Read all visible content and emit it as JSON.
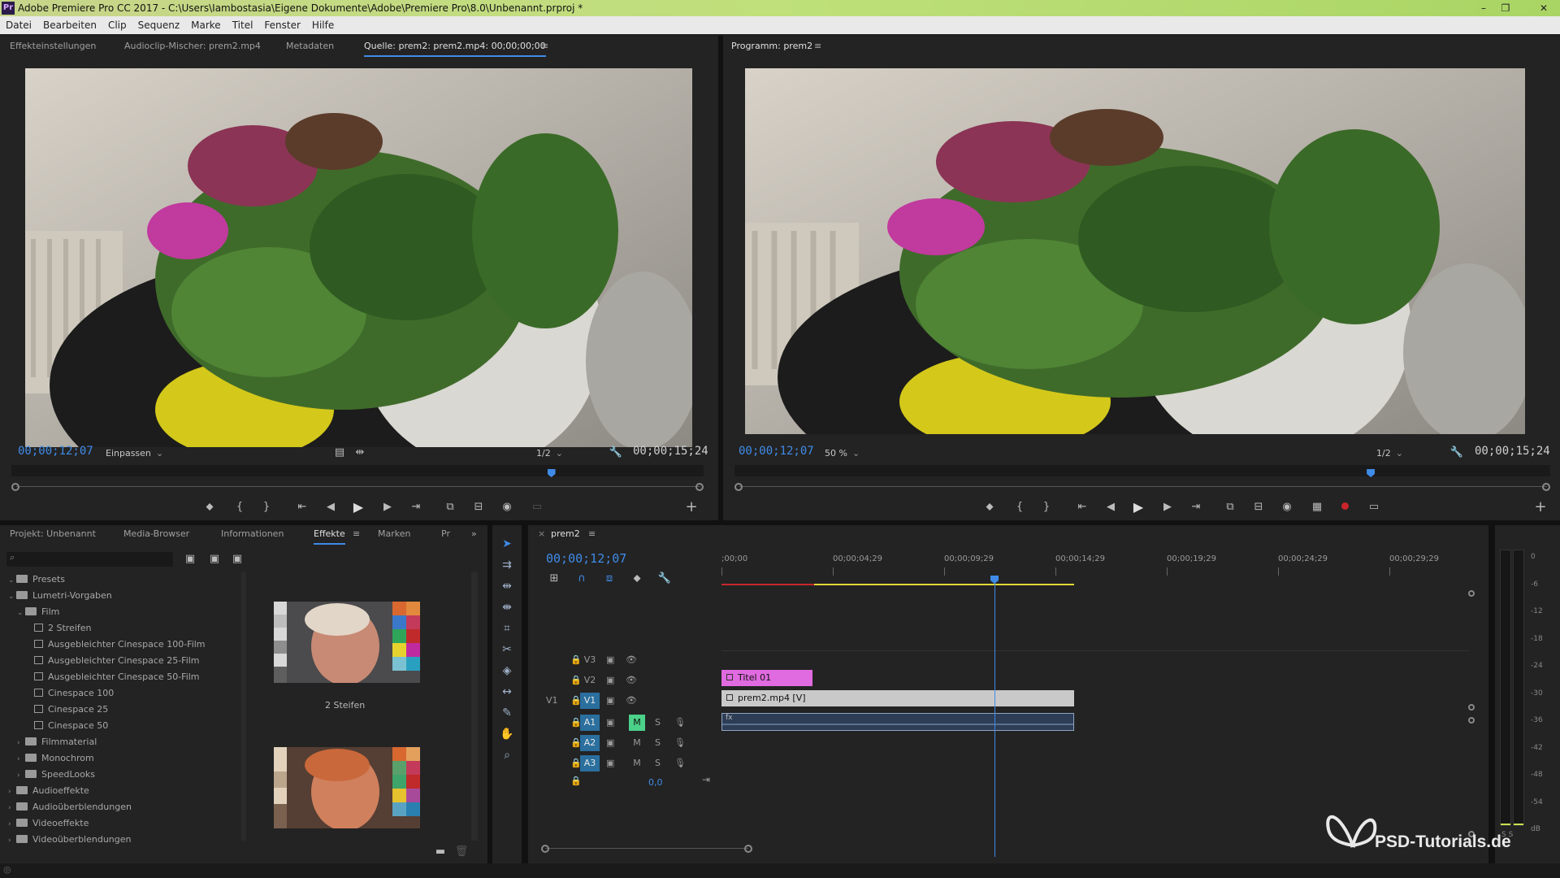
{
  "app": {
    "title": "Adobe Premiere Pro CC 2017 - C:\\Users\\Iambostasia\\Eigene Dokumente\\Adobe\\Premiere Pro\\8.0\\Unbenannt.prproj *",
    "icon_label": "Pr"
  },
  "menu": [
    "Datei",
    "Bearbeiten",
    "Clip",
    "Sequenz",
    "Marke",
    "Titel",
    "Fenster",
    "Hilfe"
  ],
  "source_panel": {
    "tabs": [
      "Effekteinstellungen",
      "Audioclip-Mischer: prem2.mp4",
      "Metadaten",
      "Quelle: prem2: prem2.mp4: 00;00;00;00"
    ],
    "active_tab": "Quelle: prem2: prem2.mp4: 00;00;00;00",
    "timecode_current": "00;00;12;07",
    "fit": "Einpassen",
    "resolution": "1/2",
    "timecode_duration": "00;00;15;24",
    "playhead_fraction": 0.78
  },
  "program_panel": {
    "title": "Programm: prem2",
    "timecode_current": "00;00;12;07",
    "zoom": "50 %",
    "resolution": "1/2",
    "timecode_duration": "00;00;15;24",
    "playhead_fraction": 0.78
  },
  "project_panel": {
    "tabs": [
      "Projekt: Unbenannt",
      "Media-Browser",
      "Informationen",
      "Effekte",
      "Marken",
      "Pr"
    ],
    "active_tab": "Effekte",
    "search_placeholder": "",
    "tree": [
      {
        "label": "Presets",
        "level": 0,
        "type": "folder",
        "expanded": true
      },
      {
        "label": "Lumetri-Vorgaben",
        "level": 0,
        "type": "folder",
        "expanded": true
      },
      {
        "label": "Film",
        "level": 1,
        "type": "folder",
        "expanded": true
      },
      {
        "label": "2 Streifen",
        "level": 2,
        "type": "preset"
      },
      {
        "label": "Ausgebleichter Cinespace 100-Film",
        "level": 2,
        "type": "preset"
      },
      {
        "label": "Ausgebleichter Cinespace 25-Film",
        "level": 2,
        "type": "preset"
      },
      {
        "label": "Ausgebleichter Cinespace 50-Film",
        "level": 2,
        "type": "preset"
      },
      {
        "label": "Cinespace 100",
        "level": 2,
        "type": "preset"
      },
      {
        "label": "Cinespace 25",
        "level": 2,
        "type": "preset"
      },
      {
        "label": "Cinespace 50",
        "level": 2,
        "type": "preset"
      },
      {
        "label": "Filmmaterial",
        "level": 1,
        "type": "folder",
        "expanded": false
      },
      {
        "label": "Monochrom",
        "level": 1,
        "type": "folder",
        "expanded": false
      },
      {
        "label": "SpeedLooks",
        "level": 1,
        "type": "folder",
        "expanded": false
      },
      {
        "label": "Audioeffekte",
        "level": 0,
        "type": "folder",
        "expanded": false
      },
      {
        "label": "Audioüberblendungen",
        "level": 0,
        "type": "folder",
        "expanded": false
      },
      {
        "label": "Videoeffekte",
        "level": 0,
        "type": "folder",
        "expanded": false
      },
      {
        "label": "Videoüberblendungen",
        "level": 0,
        "type": "folder",
        "expanded": false
      }
    ],
    "preview_caption": "2 Steifen"
  },
  "timeline": {
    "sequence_name": "prem2",
    "timecode": "00;00;12;07",
    "ruler_labels": [
      ";00;00",
      "00;00;04;29",
      "00;00;09;29",
      "00;00;14;29",
      "00;00;19;29",
      "00;00;24;29",
      "00;00;29;29"
    ],
    "tracks": [
      {
        "name": "V3",
        "kind": "video"
      },
      {
        "name": "V2",
        "kind": "video"
      },
      {
        "name": "V1",
        "kind": "video",
        "source": "V1"
      },
      {
        "name": "A1",
        "kind": "audio",
        "m_active": true
      },
      {
        "name": "A2",
        "kind": "audio",
        "m_active": false
      },
      {
        "name": "A3",
        "kind": "audio",
        "m_active": false
      }
    ],
    "mute_label": "M",
    "solo_label": "S",
    "master_value": "0,0",
    "clips": {
      "title": "Titel 01",
      "video": "prem2.mp4 [V]",
      "audio": "fx"
    },
    "playhead_fraction": 0.775
  },
  "meter": {
    "ticks": [
      "0",
      "-6",
      "-12",
      "-18",
      "-24",
      "-30",
      "-36",
      "-42",
      "-48",
      "-54",
      "dB"
    ],
    "footer": "S  S"
  },
  "watermark": "PSD-Tutorials.de",
  "colors": {
    "accent": "#3f8be7",
    "title_clip": "#e06adf",
    "video_clip": "#c9c9c9",
    "audio_clip": "#2d3d55",
    "track_active": "#2a6f9e",
    "mute_active": "#4cd18a",
    "work_area": "#e2d835",
    "render_red": "#c8262c"
  }
}
